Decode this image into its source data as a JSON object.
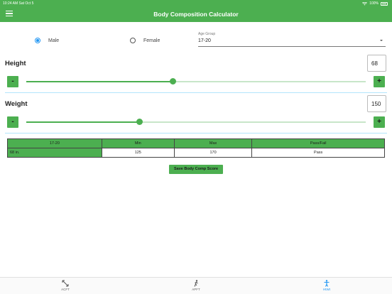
{
  "status_bar": {
    "time_date": "10:24 AM  Sat Oct 5",
    "battery_pct": "100%"
  },
  "header": {
    "title": "Body Composition Calculator",
    "menu_icon": "hamburger-menu-icon"
  },
  "gender": {
    "options": [
      {
        "label": "Male",
        "selected": true
      },
      {
        "label": "Female",
        "selected": false
      }
    ]
  },
  "age_group": {
    "label": "Age Group",
    "value": "17-20"
  },
  "height": {
    "label": "Height",
    "value": "68",
    "slider_fraction": 0.433,
    "minus_label": "-",
    "plus_label": "+"
  },
  "weight": {
    "label": "Weight",
    "value": "150",
    "slider_fraction": 0.333,
    "minus_label": "-",
    "plus_label": "+"
  },
  "results_table": {
    "headers": [
      "17-20",
      "Min",
      "Max",
      "Pass/Fail"
    ],
    "row": [
      "68 in.",
      "125",
      "170",
      "Pass"
    ]
  },
  "save_button": {
    "label": "Save Body Comp Score"
  },
  "tabs": [
    {
      "label": "ACFT",
      "icon": "arrows-icon",
      "active": false
    },
    {
      "label": "APFT",
      "icon": "runner-icon",
      "active": false
    },
    {
      "label": "HtWt",
      "icon": "person-icon",
      "active": true
    }
  ],
  "colors": {
    "primary": "#4caf50",
    "accent": "#2196f3"
  }
}
